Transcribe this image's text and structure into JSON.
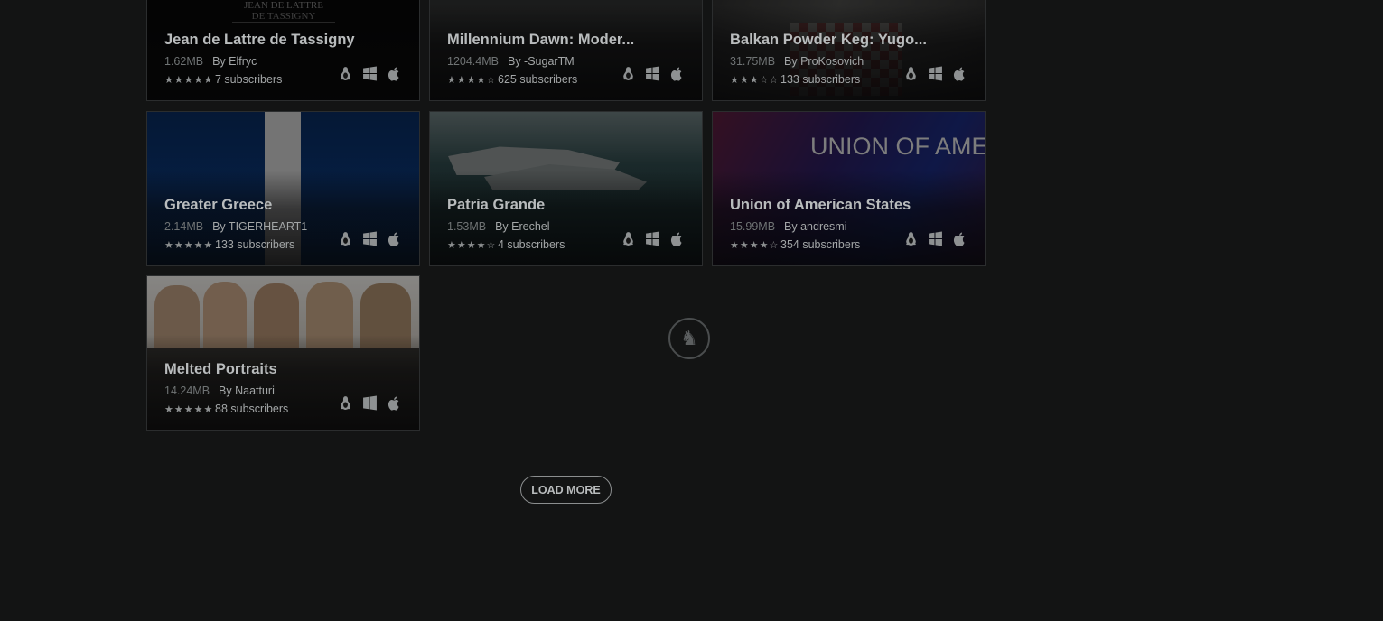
{
  "mods": [
    {
      "title": "Jean de Lattre de Tassigny",
      "size": "1.62MB",
      "author": "By Elfryc",
      "rating": "★★★★★",
      "subscribers": "7 subscribers",
      "thumb_text": "JEAN DE LATTRE\nDE TASSIGNY"
    },
    {
      "title": "Millennium Dawn: Moder...",
      "size": "1204.4MB",
      "author": "By -SugarTM",
      "rating": "★★★★☆",
      "subscribers": "625 subscribers"
    },
    {
      "title": "Balkan Powder Keg: Yugo...",
      "size": "31.75MB",
      "author": "By ProKosovich",
      "rating": "★★★☆☆",
      "subscribers": "133 subscribers"
    },
    {
      "title": "Greater Greece",
      "size": "2.14MB",
      "author": "By TIGERHEART1",
      "rating": "★★★★★",
      "subscribers": "133 subscribers"
    },
    {
      "title": "Patria Grande",
      "size": "1.53MB",
      "author": "By Erechel",
      "rating": "★★★★☆",
      "subscribers": "4 subscribers"
    },
    {
      "title": "Union of American States",
      "size": "15.99MB",
      "author": "By andresmi",
      "rating": "★★★★☆",
      "subscribers": "354 subscribers",
      "thumb_text": "UNION OF AMERICAN"
    },
    {
      "title": "Melted Portraits",
      "size": "14.24MB",
      "author": "By Naatturi",
      "rating": "★★★★★",
      "subscribers": "88 subscribers"
    }
  ],
  "os_icons": [
    "linux-icon",
    "windows-icon",
    "apple-icon"
  ],
  "load_more_label": "LOAD MORE",
  "colors": {
    "background": "#131414",
    "card_border": "#2b2d2e",
    "title": "#b9bcbd",
    "muted": "#6f7374"
  }
}
